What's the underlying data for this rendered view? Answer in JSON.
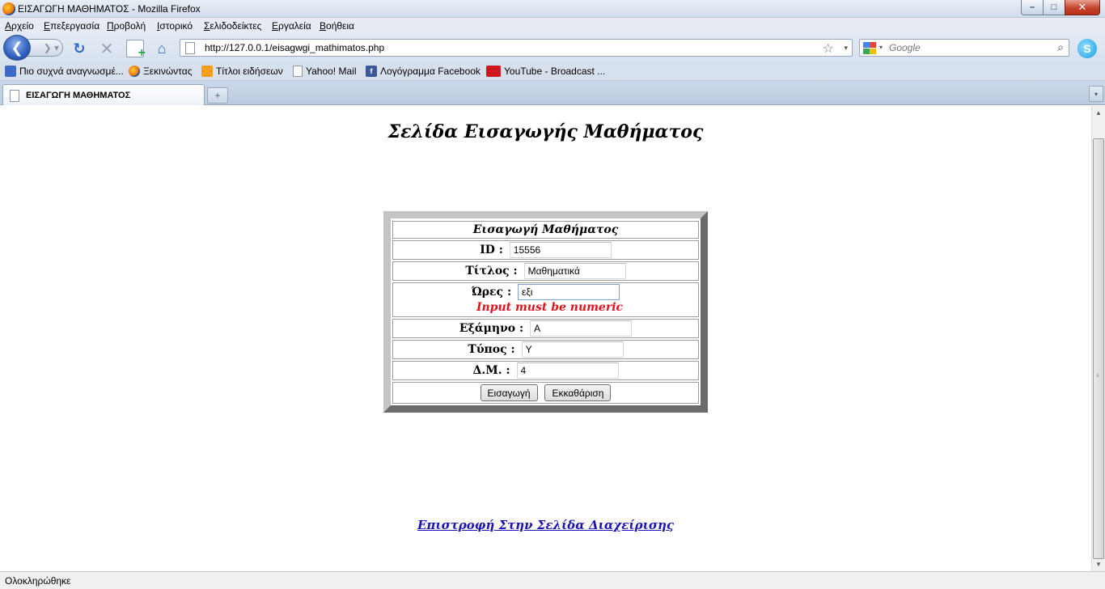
{
  "window": {
    "title": "ΕΙΣΑΓΩΓΗ ΜΑΘΗΜΑΤΟΣ - Mozilla Firefox",
    "minimize": "–",
    "maximize": "□",
    "close": "✕"
  },
  "menu": {
    "items": [
      {
        "first": "Α",
        "rest": "ρχείο"
      },
      {
        "first": "Ε",
        "rest": "πεξεργασία"
      },
      {
        "first": "Π",
        "rest": "ροβολή"
      },
      {
        "first": "Ι",
        "rest": "στορικό"
      },
      {
        "first": "Σ",
        "rest": "ελιδοδείκτες"
      },
      {
        "first": "Ε",
        "rest": "ργαλεία"
      },
      {
        "first": "Β",
        "rest": "οήθεια"
      }
    ]
  },
  "nav": {
    "back_glyph": "❮",
    "forward_glyph": "❯ ▾",
    "reload_glyph": "↻",
    "stop_glyph": "✕",
    "home_glyph": "⌂",
    "url": "http://127.0.0.1/eisagwgi_mathimatos.php",
    "star_glyph": "☆",
    "dropdown_glyph": "▾",
    "search_placeholder": "Google",
    "search_engine_dropdown": "▾",
    "search_glyph": "⌕",
    "skype_glyph": "S"
  },
  "bookmarks": [
    {
      "label": "Πιο συχνά αναγνωσμέ...",
      "icon": "most-visited-icon",
      "color": "#3b6cc4"
    },
    {
      "label": "Ξεκινώντας",
      "icon": "firefox-icon",
      "color": "#e66b0c"
    },
    {
      "label": "Τίτλοι ειδήσεων",
      "icon": "rss-icon",
      "color": "#f29b1d"
    },
    {
      "label": "Yahoo! Mail",
      "icon": "page-icon",
      "color": "#ffffff"
    },
    {
      "label": "Λογόγραμμα Facebook",
      "icon": "facebook-icon",
      "color": "#3b5998"
    },
    {
      "label": "YouTube - Broadcast ...",
      "icon": "youtube-icon",
      "color": "#cc181e"
    }
  ],
  "tabs": {
    "active_label": "ΕΙΣΑΓΩΓΗ ΜΑΘΗΜΑΤΟΣ",
    "new_tab_glyph": "+",
    "list_glyph": "▾"
  },
  "page": {
    "heading": "Σελίδα Εισαγωγής Μαθήματος",
    "form": {
      "title": "Εισαγωγή Μαθήματος",
      "id_label": "ID :",
      "id_value": "15556",
      "title_label": "Τίτλος :",
      "title_value": "Μαθηματικά",
      "hours_label": "Ώρες :",
      "hours_value": "εξι",
      "hours_error": "Input must be numeric",
      "semester_label": "Εξάμηνο :",
      "semester_value": "Α",
      "type_label": "Τύπος :",
      "type_value": "Υ",
      "dm_label": "Δ.Μ. :",
      "dm_value": "4",
      "submit_label": "Εισαγωγή",
      "reset_label": "Εκκαθάριση"
    },
    "back_link": "Επιστροφή Στην Σελίδα Διαχείρισης"
  },
  "scrollbar": {
    "up_glyph": "▲",
    "down_glyph": "▼",
    "grip": "≡"
  },
  "status": {
    "text": "Ολοκληρώθηκε"
  },
  "colors": {
    "error": "#e0111b",
    "link": "#1a12b5"
  }
}
